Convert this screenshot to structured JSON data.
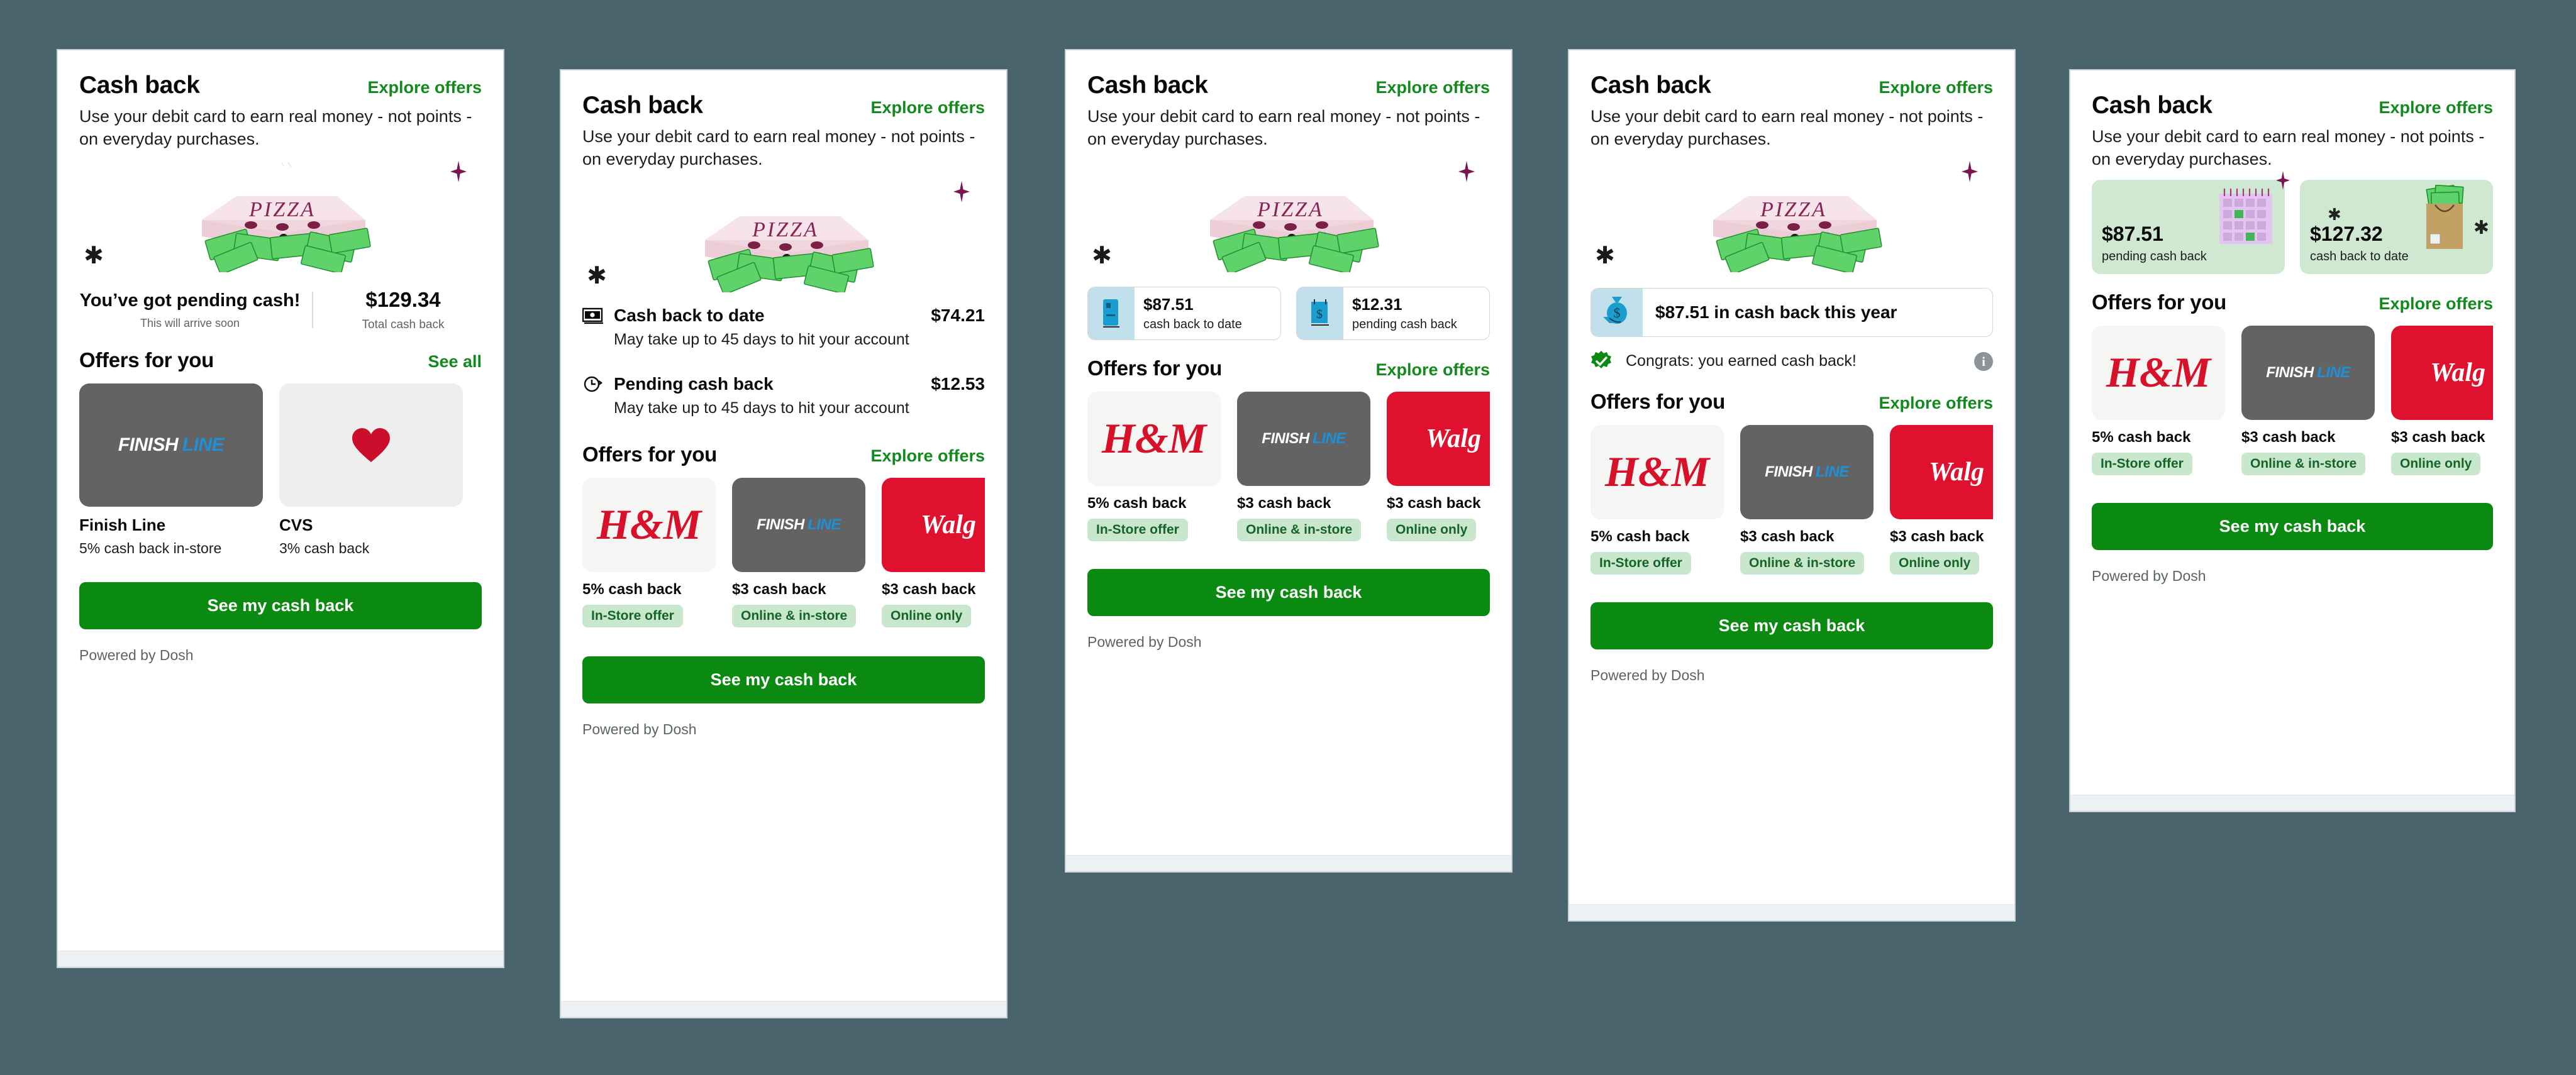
{
  "background_color": "#49646c",
  "accent_green": "#138a1e",
  "cta_green": "#0a8a11",
  "common": {
    "title": "Cash back",
    "explore_offers": "Explore offers",
    "see_all": "See all",
    "subtitle": "Use your debit card to earn real money - not points - on everyday purchases.",
    "offers_title": "Offers for you",
    "cta": "See my cash back",
    "powered_by": "Powered by Dosh",
    "icons": {
      "pizza": "pizza-box-with-cash-illustration",
      "sparkle": "sparkle-icon",
      "burst": "burst-star-icon",
      "money_stack": "money-stack-icon",
      "clock": "clock-arrow-icon",
      "phone_cash": "phone-cash-icon",
      "cash_note": "cash-note-icon",
      "money_bag_hand": "money-bag-in-hand-icon",
      "check_badge": "green-check-badge-icon",
      "info": "info-icon",
      "calendar": "calendar-illustration",
      "grocery_bag": "grocery-bag-with-cash-illustration"
    }
  },
  "offers_catalog": {
    "hm": {
      "name": "H&M",
      "logo": "hm-logo",
      "amount": "5% cash back",
      "badge": "In-Store offer",
      "bg": "#f5f5f3"
    },
    "fl": {
      "name": "Finish Line",
      "logo": "finish-line-logo",
      "amount": "$3 cash back",
      "badge": "Online & in-store",
      "bg": "#636363"
    },
    "wg": {
      "name": "Walgreens",
      "logo": "walgreens-logo",
      "amount": "$3 cash back",
      "badge": "Online only",
      "bg": "#e0112e"
    }
  },
  "cards": [
    {
      "id": "card-pending-cash",
      "variant": "hero",
      "hero": {
        "headline": "You’ve got pending cash!",
        "note": "This will arrive soon",
        "amount": "$129.34",
        "amount_label": "Total cash back"
      },
      "offers_link": "See all",
      "offers": [
        {
          "name": "Finish Line",
          "logo": "finish-line-logo",
          "desc": "5% cash back in-store",
          "bg": "#636363"
        },
        {
          "name": "CVS",
          "logo": "cvs-logo",
          "desc": "3% cash back",
          "bg": "#eeeeee"
        }
      ]
    },
    {
      "id": "card-stat-rows",
      "variant": "rows",
      "stats": [
        {
          "icon": "money-stack-icon",
          "label": "Cash back to date",
          "value": "$74.21",
          "note": "May take up to 45 days to hit your account"
        },
        {
          "icon": "clock-arrow-icon",
          "label": "Pending cash back",
          "value": "$12.53",
          "note": "May take up to 45 days to hit your account"
        }
      ],
      "offers_link": "Explore offers",
      "offers": [
        "hm",
        "fl",
        "wg"
      ]
    },
    {
      "id": "card-pill-stats",
      "variant": "pills",
      "pills": [
        {
          "icon": "phone-cash-icon",
          "amount": "$87.51",
          "label": "cash back to date"
        },
        {
          "icon": "cash-note-icon",
          "amount": "$12.31",
          "label": "pending cash back"
        }
      ],
      "offers_link": "Explore offers",
      "offers": [
        "hm",
        "fl",
        "wg"
      ]
    },
    {
      "id": "card-banner",
      "variant": "banner",
      "banner": {
        "icon": "money-bag-in-hand-icon",
        "text": "$87.51 in cash back this year"
      },
      "congrats": {
        "icon": "green-check-badge-icon",
        "text": "Congrats: you earned cash back!",
        "info": "i"
      },
      "offers_link": "Explore offers",
      "offers": [
        "hm",
        "fl",
        "wg"
      ]
    },
    {
      "id": "card-green-tiles",
      "variant": "tiles",
      "tiles": [
        {
          "art": "calendar-illustration",
          "amount": "$87.51",
          "label": "pending cash back"
        },
        {
          "art": "grocery-bag-with-cash-illustration",
          "amount": "$127.32",
          "label": "cash back to date"
        }
      ],
      "offers_link": "Explore offers",
      "offers": [
        "hm",
        "fl",
        "wg"
      ]
    }
  ]
}
